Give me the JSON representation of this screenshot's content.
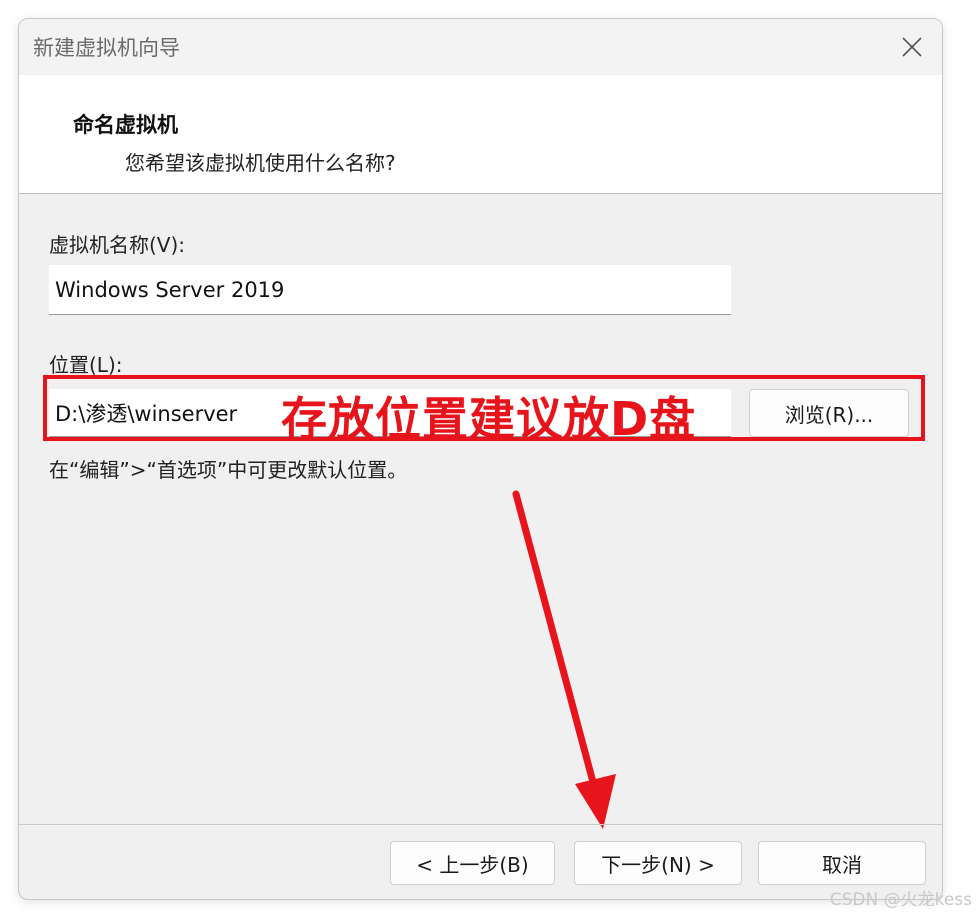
{
  "window": {
    "title": "新建虚拟机向导",
    "close_icon": "close-icon"
  },
  "header": {
    "title": "命名虚拟机",
    "subtitle": "您希望该虚拟机使用什么名称?"
  },
  "form": {
    "name_label": "虚拟机名称(V):",
    "name_value": "Windows Server 2019",
    "location_label": "位置(L):",
    "location_value": "D:\\渗透\\winserver",
    "browse_label": "浏览(R)...",
    "hint": "在“编辑”>“首选项”中可更改默认位置。"
  },
  "footer": {
    "back_label": "< 上一步(B)",
    "next_label": "下一步(N) >",
    "cancel_label": "取消"
  },
  "annotation": {
    "text": "存放位置建议放D盘",
    "color": "#e8141c"
  },
  "watermark": "CSDN @火龙kess"
}
